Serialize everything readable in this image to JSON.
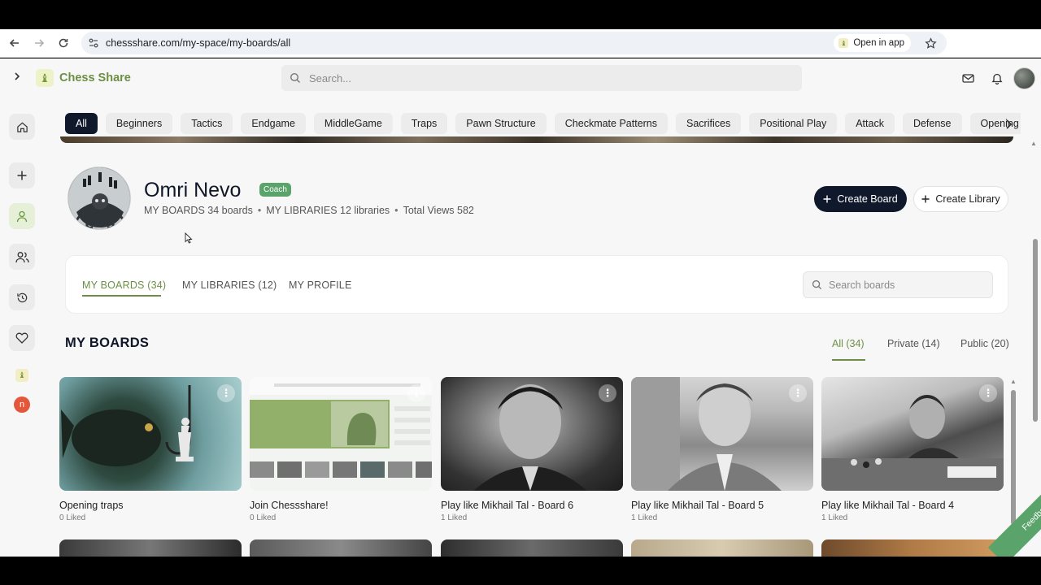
{
  "browser": {
    "url": "chessshare.com/my-space/my-boards/all",
    "open_in_app": "Open in app"
  },
  "app": {
    "brand": "Chess Share",
    "search_placeholder": "Search..."
  },
  "sidebar": {
    "avatar_letter": "n"
  },
  "categories": [
    "All",
    "Beginners",
    "Tactics",
    "Endgame",
    "MiddleGame",
    "Traps",
    "Pawn Structure",
    "Checkmate Patterns",
    "Sacrifices",
    "Positional Play",
    "Attack",
    "Defense",
    "Opening"
  ],
  "profile": {
    "name": "Omri Nevo",
    "badge": "Coach",
    "boards_stat": "MY BOARDS 34 boards",
    "libraries_stat": "MY LIBRARIES 12 libraries",
    "views_stat": "Total Views 582",
    "create_board": "Create Board",
    "create_library": "Create Library"
  },
  "tabs": {
    "boards": "MY BOARDS (34)",
    "libraries": "MY LIBRARIES (12)",
    "profile": "MY PROFILE",
    "search_placeholder": "Search boards"
  },
  "section": {
    "title": "MY BOARDS",
    "filter_all": "All (34)",
    "filter_private": "Private (14)",
    "filter_public": "Public (20)"
  },
  "boards": [
    {
      "title": "Opening traps",
      "likes": "0 Liked"
    },
    {
      "title": "Join Chessshare!",
      "likes": "0 Liked"
    },
    {
      "title": "Play like Mikhail Tal - Board 6",
      "likes": "1 Liked"
    },
    {
      "title": "Play like Mikhail Tal - Board 5",
      "likes": "1 Liked"
    },
    {
      "title": "Play like Mikhail Tal - Board 4",
      "likes": "1 Liked"
    }
  ],
  "feedback": "Feedback",
  "colors": {
    "accent_green": "#6c8f45",
    "navy": "#10182b",
    "badge_green": "#5aa36a"
  }
}
